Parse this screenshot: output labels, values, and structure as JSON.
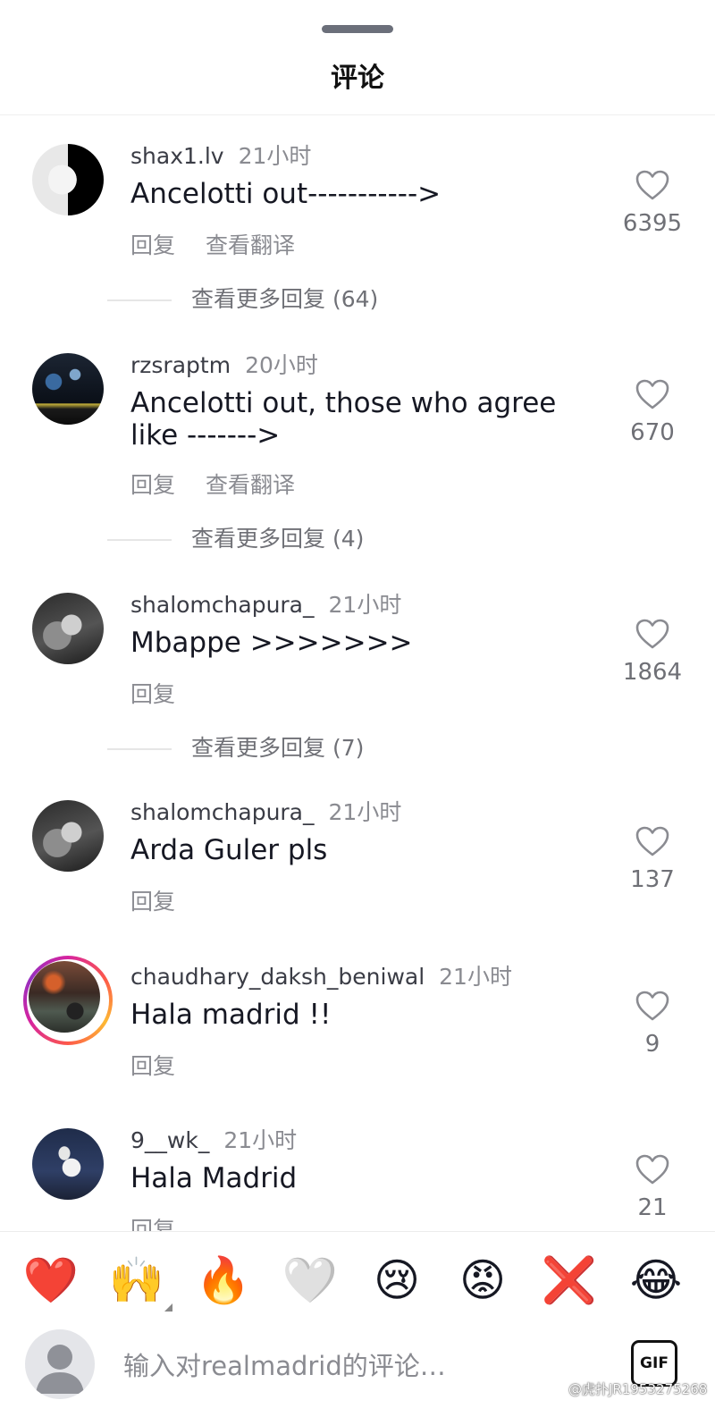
{
  "header": {
    "title": "评论"
  },
  "comments": [
    {
      "user": "shax1.lv",
      "time": "21小时",
      "text": "Ancelotti out----------->",
      "actions": [
        "回复",
        "查看翻译"
      ],
      "likes": "6395",
      "more_replies": "查看更多回复 (64)"
    },
    {
      "user": "rzsraptm",
      "time": "20小时",
      "text": "Ancelotti out, those who agree like ------->",
      "actions": [
        "回复",
        "查看翻译"
      ],
      "likes": "670",
      "more_replies": "查看更多回复 (4)"
    },
    {
      "user": "shalomchapura_",
      "time": "21小时",
      "text": "Mbappe >>>>>>>",
      "actions": [
        "回复"
      ],
      "likes": "1864",
      "more_replies": "查看更多回复 (7)"
    },
    {
      "user": "shalomchapura_",
      "time": "21小时",
      "text": "Arda Guler pls",
      "actions": [
        "回复"
      ],
      "likes": "137"
    },
    {
      "user": "chaudhary_daksh_beniwal",
      "time": "21小时",
      "text": "Hala madrid !!",
      "actions": [
        "回复"
      ],
      "likes": "9"
    },
    {
      "user": "9__wk_",
      "time": "21小时",
      "text": "Hala Madrid",
      "actions": [
        "回复"
      ],
      "likes": "21"
    }
  ],
  "emoji_bar": [
    "❤️",
    "🙌",
    "🔥",
    "🤍",
    "😢",
    "😡",
    "❌",
    "😂"
  ],
  "input": {
    "placeholder": "输入对realmadrid的评论…",
    "gif_label": "GIF"
  },
  "watermark": "@虎扑JR1953275268",
  "colors": {
    "heart_outline": "#8a8b91",
    "story_ring": "#d6249f"
  }
}
